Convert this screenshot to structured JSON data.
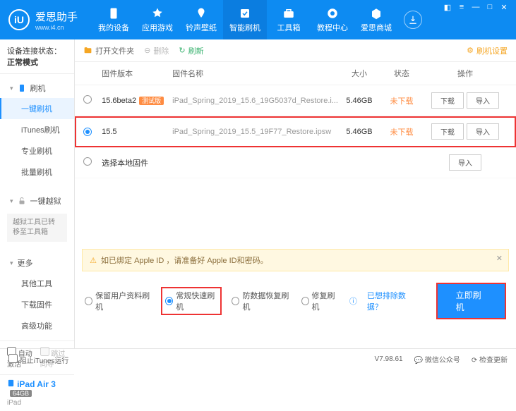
{
  "brand": {
    "name": "爱思助手",
    "url": "www.i4.cn",
    "logo_text": "iU"
  },
  "nav": {
    "items": [
      {
        "label": "我的设备"
      },
      {
        "label": "应用游戏"
      },
      {
        "label": "铃声壁纸"
      },
      {
        "label": "智能刷机"
      },
      {
        "label": "工具箱"
      },
      {
        "label": "教程中心"
      },
      {
        "label": "爱思商城"
      }
    ],
    "active_index": 3
  },
  "sidebar": {
    "conn_label": "设备连接状态：",
    "conn_value": "正常模式",
    "groups": {
      "flash": {
        "head": "刷机",
        "items": [
          "一键刷机",
          "iTunes刷机",
          "专业刷机",
          "批量刷机"
        ],
        "active_index": 0
      },
      "jailbreak": {
        "head": "一键越狱",
        "note": "越狱工具已转移至工具箱"
      },
      "more": {
        "head": "更多",
        "items": [
          "其他工具",
          "下载固件",
          "高级功能"
        ]
      }
    },
    "foot": {
      "auto_activate": "自动激活",
      "skip_guide": "跳过向导"
    },
    "device": {
      "name": "iPad Air 3",
      "badge": "64GB",
      "type": "iPad"
    }
  },
  "toolbar": {
    "open": "打开文件夹",
    "delete": "删除",
    "refresh": "刷新",
    "settings": "刷机设置"
  },
  "table": {
    "headers": {
      "version": "固件版本",
      "name": "固件名称",
      "size": "大小",
      "status": "状态",
      "ops": "操作"
    },
    "rows": [
      {
        "selected": false,
        "version": "15.6beta2",
        "badge": "测试版",
        "name": "iPad_Spring_2019_15.6_19G5037d_Restore.i...",
        "size": "5.46GB",
        "status": "未下载",
        "ops": [
          "下载",
          "导入"
        ]
      },
      {
        "selected": true,
        "version": "15.5",
        "badge": "",
        "name": "iPad_Spring_2019_15.5_19F77_Restore.ipsw",
        "size": "5.46GB",
        "status": "未下载",
        "ops": [
          "下载",
          "导入"
        ]
      }
    ],
    "local_row": {
      "label": "选择本地固件",
      "op": "导入"
    }
  },
  "warn": "如已绑定 Apple ID ，请准备好 Apple ID和密码。",
  "options": {
    "keep_data": "保留用户资料刷机",
    "normal_fast": "常规快速刷机",
    "anti_recovery": "防数据恢复刷机",
    "repair": "修复刷机",
    "exclude_link": "已想排除数据？",
    "go": "立即刷机",
    "selected": "normal_fast"
  },
  "statusbar": {
    "block_itunes": "阻止iTunes运行",
    "version": "V7.98.61",
    "wechat": "微信公众号",
    "check_update": "检查更新"
  }
}
